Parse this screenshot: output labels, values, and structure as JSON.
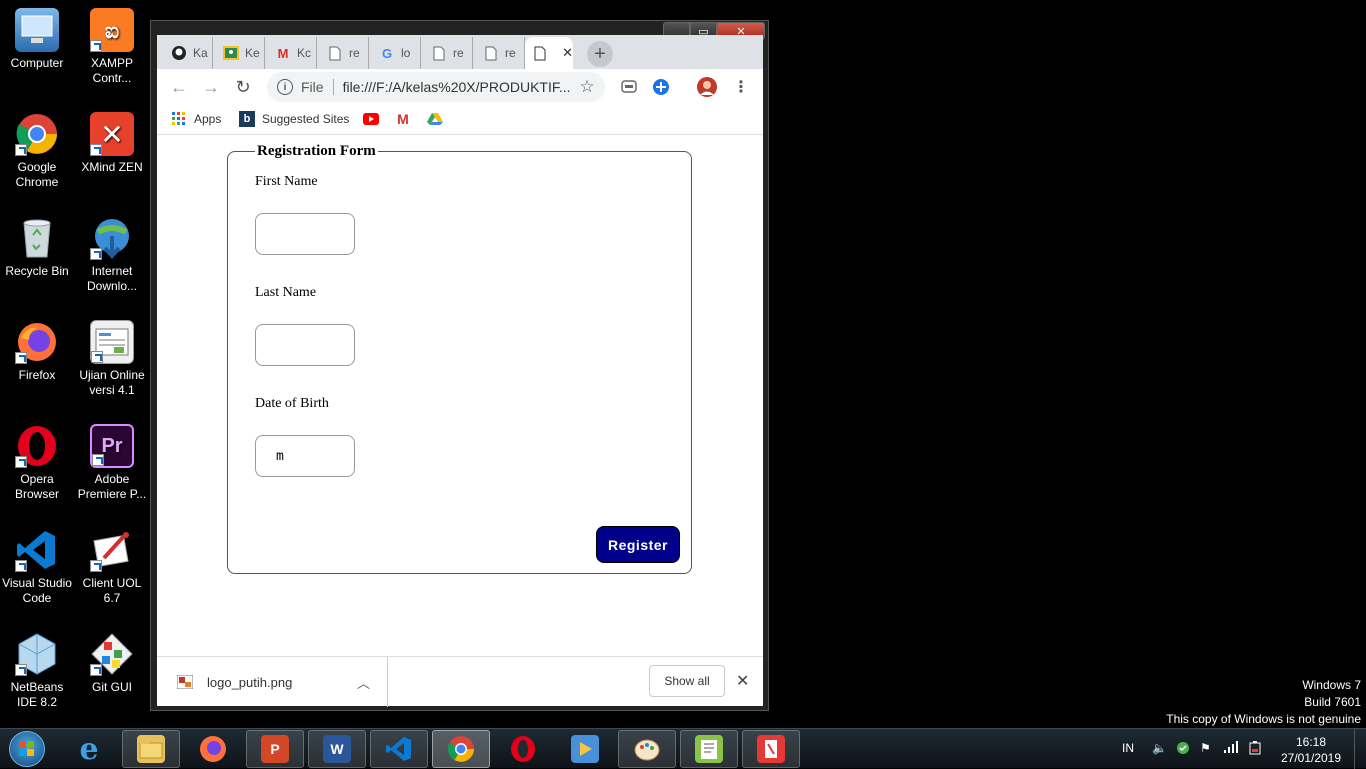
{
  "desktop": {
    "icons": [
      {
        "label": "Computer",
        "icon": "computer-icon"
      },
      {
        "label": "XAMPP Contr...",
        "icon": "xampp-icon"
      },
      {
        "label": "Google Chrome",
        "icon": "chrome-icon"
      },
      {
        "label": "XMind ZEN",
        "icon": "xmind-icon"
      },
      {
        "label": "Recycle Bin",
        "icon": "recycle-bin-icon"
      },
      {
        "label": "Internet Downlo...",
        "icon": "idm-icon"
      },
      {
        "label": "Firefox",
        "icon": "firefox-icon"
      },
      {
        "label": "Ujian Online versi 4.1",
        "icon": "ujian-online-icon"
      },
      {
        "label": "Opera Browser",
        "icon": "opera-icon"
      },
      {
        "label": "Adobe Premiere P...",
        "icon": "premiere-icon"
      },
      {
        "label": "Visual Studio Code",
        "icon": "vscode-icon"
      },
      {
        "label": "Client UOL 6.7",
        "icon": "client-uol-icon"
      },
      {
        "label": "NetBeans IDE 8.2",
        "icon": "netbeans-icon"
      },
      {
        "label": "Git GUI",
        "icon": "git-gui-icon"
      }
    ]
  },
  "browser": {
    "tabs": [
      {
        "title": "Ka",
        "icon": "github-icon"
      },
      {
        "title": "Ke",
        "icon": "classroom-icon"
      },
      {
        "title": "Kc",
        "icon": "gmail-icon"
      },
      {
        "title": "re",
        "icon": "page-icon"
      },
      {
        "title": "lo",
        "icon": "google-icon"
      },
      {
        "title": "re",
        "icon": "page-icon"
      },
      {
        "title": "re",
        "icon": "page-icon"
      },
      {
        "title": "",
        "icon": "page-icon",
        "active": true
      }
    ],
    "new_tab_symbol": "+",
    "address": {
      "scheme_label": "File",
      "url": "file:///F:/A/kelas%20X/PRODUKTIF..."
    },
    "bookmarks": [
      {
        "label": "Apps",
        "icon": "apps-grid-icon"
      },
      {
        "label": "Suggested Sites",
        "icon": "bing-icon"
      },
      {
        "label": "",
        "icon": "youtube-icon"
      },
      {
        "label": "",
        "icon": "gmail-icon"
      },
      {
        "label": "",
        "icon": "drive-icon"
      }
    ],
    "download": {
      "filename": "logo_putih.png",
      "show_all": "Show all"
    }
  },
  "form": {
    "legend": "Registration Form",
    "first_name_label": "First Name",
    "first_name_value": "",
    "last_name_label": "Last Name",
    "last_name_value": "",
    "dob_label": "Date of Birth",
    "dob_value": "m",
    "register_label": "Register",
    "register_color": "#00008b"
  },
  "watermark": {
    "line1": "Windows 7",
    "line2": "Build 7601",
    "line3": "This copy of Windows is not genuine"
  },
  "taskbar": {
    "apps": [
      "internet-explorer-icon",
      "file-explorer-icon",
      "firefox-icon",
      "powerpoint-icon",
      "word-icon",
      "vscode-icon",
      "chrome-icon",
      "opera-icon",
      "media-player-icon",
      "paint-icon",
      "notepad-plus-icon",
      "client-uol-icon"
    ],
    "language": "IN",
    "time": "16:18",
    "date": "27/01/2019"
  }
}
